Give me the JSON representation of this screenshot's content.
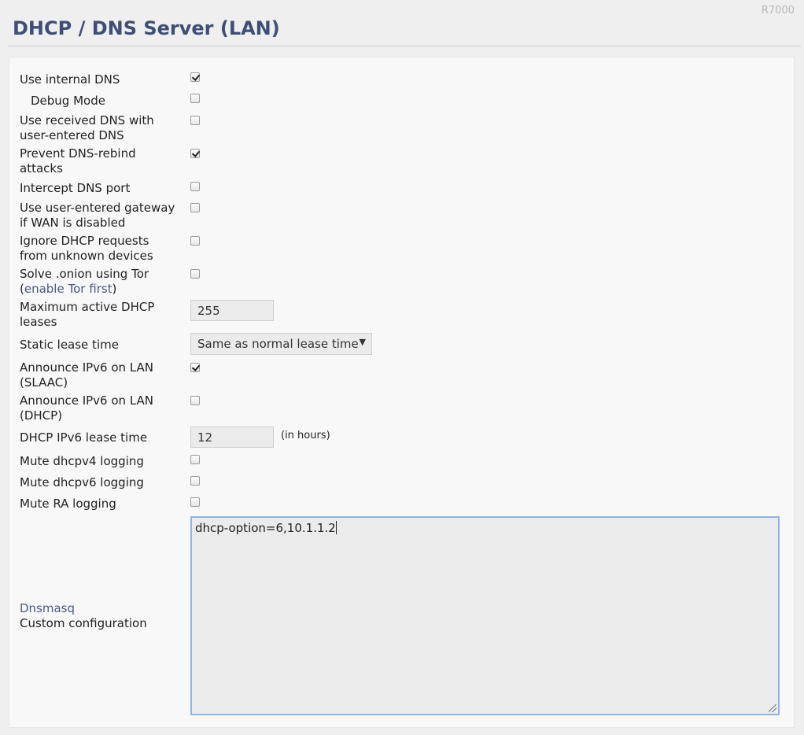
{
  "router_model": "R7000",
  "page": {
    "title": "DHCP / DNS Server (LAN)"
  },
  "settings": {
    "use_internal_dns": {
      "label": "Use internal DNS",
      "checked": true
    },
    "debug_mode": {
      "label": "Debug Mode",
      "checked": false
    },
    "use_received_dns": {
      "label": "Use received DNS with user-entered DNS",
      "checked": false
    },
    "prevent_rebind": {
      "label": "Prevent DNS-rebind attacks",
      "checked": true
    },
    "intercept_dns": {
      "label": "Intercept DNS port",
      "checked": false
    },
    "user_gateway": {
      "label": "Use user-entered gateway if WAN is disabled",
      "checked": false
    },
    "ignore_unknown": {
      "label": "Ignore DHCP requests from unknown devices",
      "checked": false
    },
    "solve_onion": {
      "label": "Solve .onion using Tor",
      "link_open": "(",
      "link": "enable Tor first",
      "link_close": ")",
      "checked": false
    },
    "max_leases": {
      "label": "Maximum active DHCP leases",
      "value": "255"
    },
    "static_lease": {
      "label": "Static lease time",
      "selected": "Same as normal lease time"
    },
    "announce_slaac": {
      "label": "Announce IPv6 on LAN (SLAAC)",
      "checked": true
    },
    "announce_dhcp": {
      "label": "Announce IPv6 on LAN (DHCP)",
      "checked": false
    },
    "ipv6_lease": {
      "label": "DHCP IPv6 lease time",
      "value": "12",
      "hint": "(in hours)"
    },
    "mute_v4": {
      "label": "Mute dhcpv4 logging",
      "checked": false
    },
    "mute_v6": {
      "label": "Mute dhcpv6 logging",
      "checked": false
    },
    "mute_ra": {
      "label": "Mute RA logging",
      "checked": false
    },
    "custom_config": {
      "link": "Dnsmasq",
      "label": "Custom configuration",
      "value": "dhcp-option=6,10.1.1.2"
    }
  }
}
